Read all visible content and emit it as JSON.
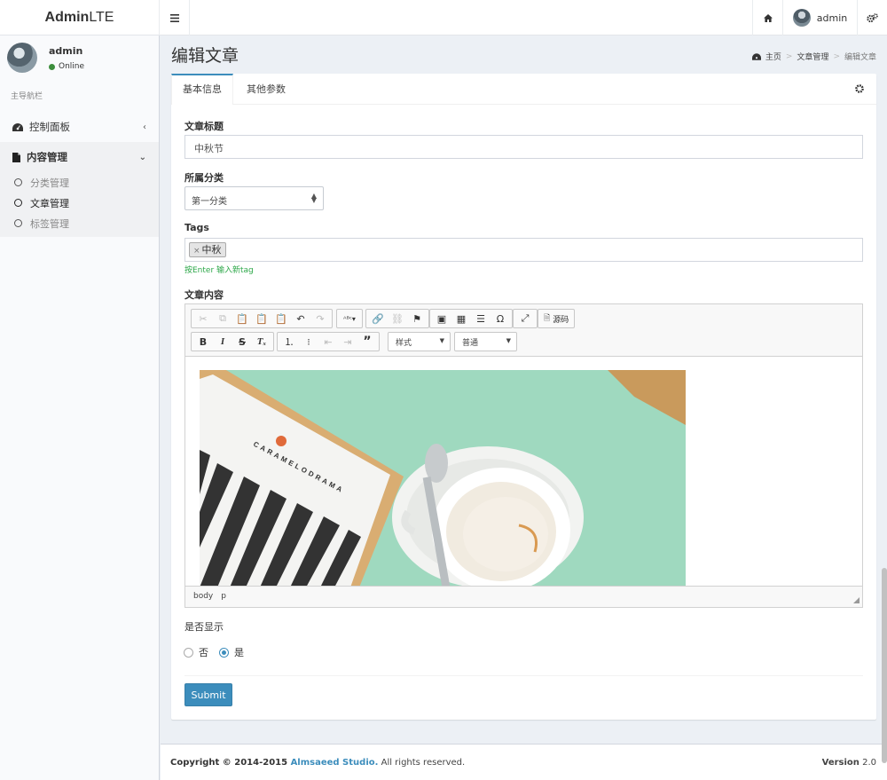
{
  "brand": {
    "bold": "Admin",
    "light": "LTE"
  },
  "topnav": {
    "user_name": "admin"
  },
  "sidebar": {
    "user_name": "admin",
    "status": "Online",
    "header": "主导航栏",
    "items": [
      {
        "label": "控制面板"
      },
      {
        "label": "内容管理"
      }
    ],
    "sub_items": [
      {
        "label": "分类管理"
      },
      {
        "label": "文章管理"
      },
      {
        "label": "标签管理"
      }
    ]
  },
  "page": {
    "title": "编辑文章"
  },
  "breadcrumb": {
    "home": "主页",
    "section": "文章管理",
    "current": "编辑文章"
  },
  "tabs": [
    {
      "label": "基本信息"
    },
    {
      "label": "其他参数"
    }
  ],
  "form": {
    "title_label": "文章标题",
    "title_value": "中秋节",
    "category_label": "所属分类",
    "category_value": "第一分类",
    "tags_label": "Tags",
    "tags": [
      "中秋"
    ],
    "tags_help": "按Enter 输入新tag",
    "content_label": "文章内容",
    "show_label": "是否显示",
    "show_options": [
      {
        "label": "否",
        "selected": false
      },
      {
        "label": "是",
        "selected": true
      }
    ],
    "submit_label": "Submit"
  },
  "editor": {
    "source_label": "源码",
    "style_combo": "样式",
    "format_combo": "普通",
    "path": [
      "body",
      "p"
    ],
    "image_text": "CARAMELODRAMA",
    "toolbar_icons": [
      "cut-icon",
      "copy-icon",
      "paste-icon",
      "paste-text-icon",
      "paste-word-icon",
      "undo-icon",
      "redo-icon",
      "spellcheck-icon",
      "link-icon",
      "unlink-icon",
      "anchor-icon",
      "image-icon",
      "table-icon",
      "horizontal-rule-icon",
      "special-char-icon",
      "maximize-icon",
      "source-icon",
      "bold-icon",
      "italic-icon",
      "strike-icon",
      "remove-format-icon",
      "numbered-list-icon",
      "bulleted-list-icon",
      "outdent-icon",
      "indent-icon",
      "blockquote-icon"
    ]
  },
  "footer": {
    "copyright": "Copyright © 2014-2015 ",
    "company": "Almsaeed Studio.",
    "rights": " All rights reserved.",
    "version_label": "Version",
    "version": "2.0"
  },
  "colors": {
    "primary": "#3c8dbc",
    "online": "#3c8d3c",
    "help": "#2ea84a",
    "background": "#ecf0f5"
  }
}
